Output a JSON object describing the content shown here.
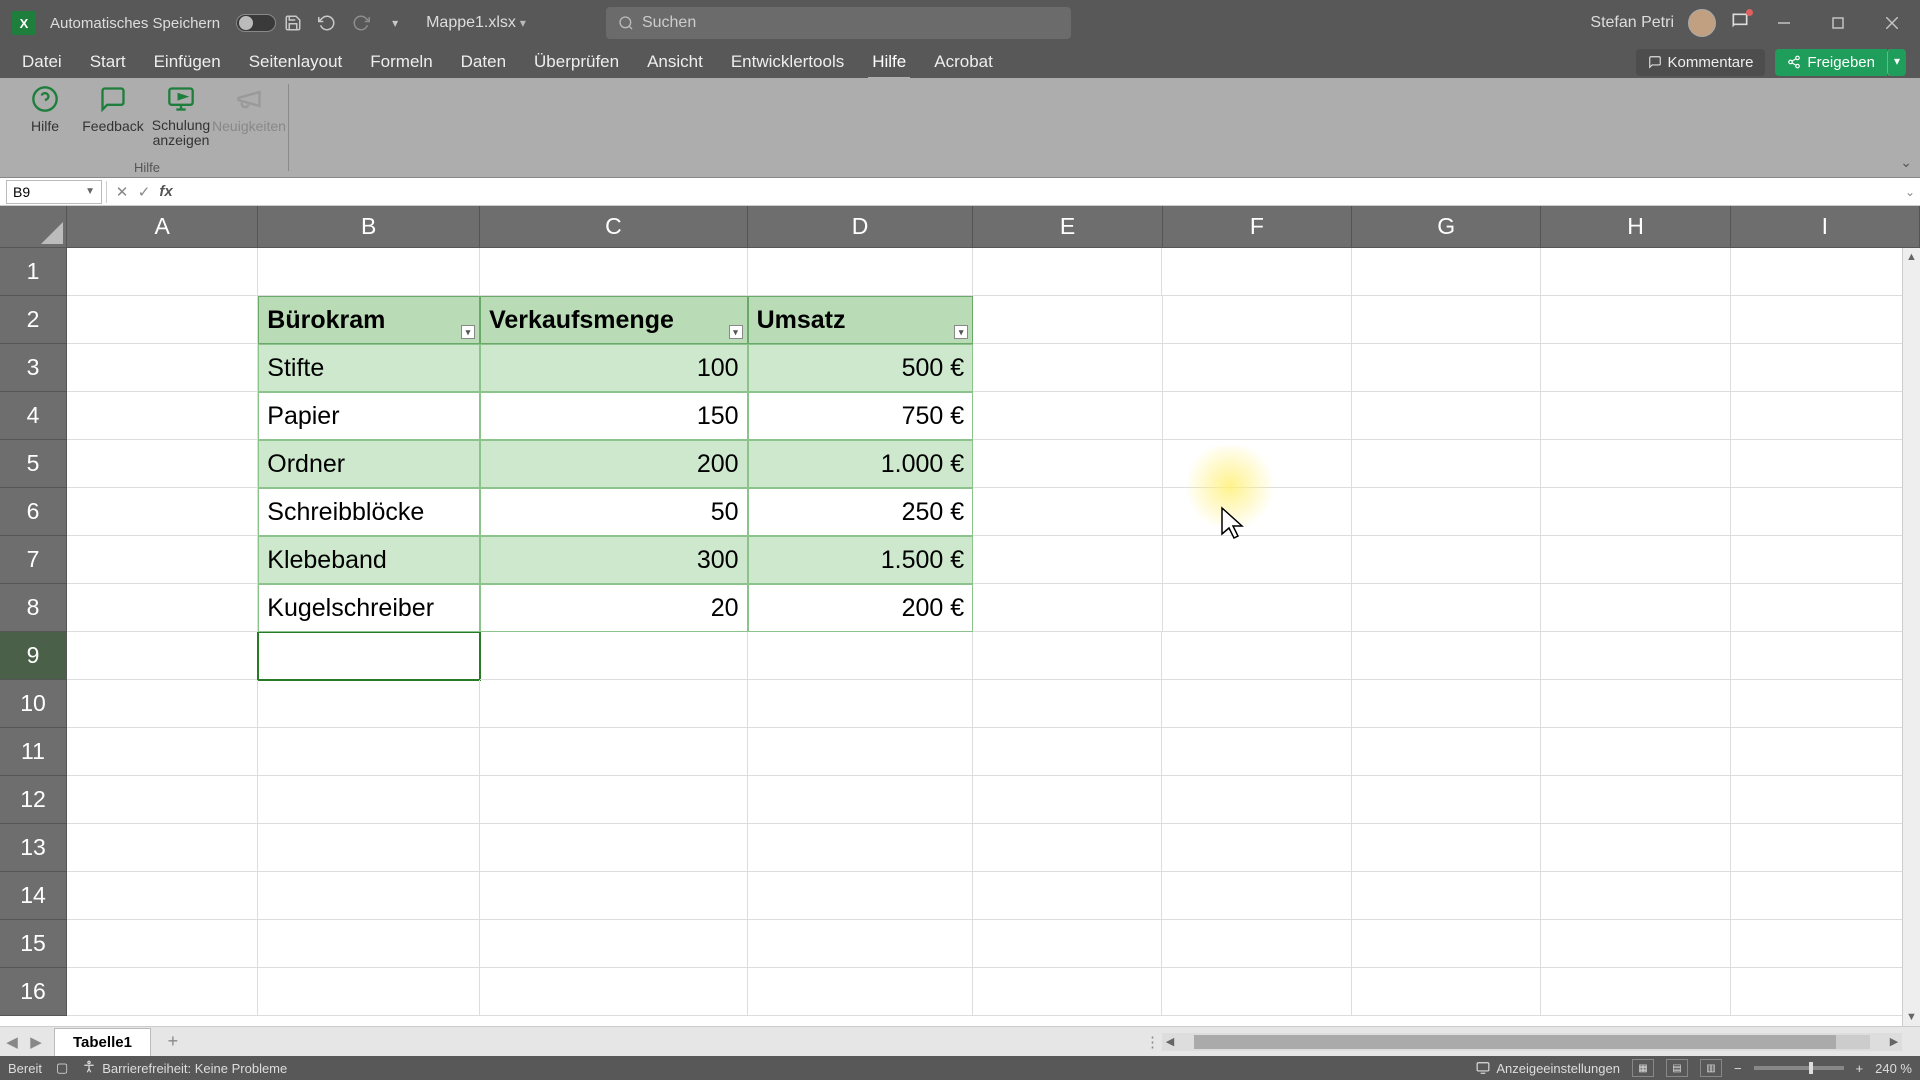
{
  "titlebar": {
    "autosave_label": "Automatisches Speichern",
    "doc_name": "Mappe1.xlsx",
    "search_placeholder": "Suchen",
    "user_name": "Stefan Petri"
  },
  "tabs": {
    "items": [
      "Datei",
      "Start",
      "Einfügen",
      "Seitenlayout",
      "Formeln",
      "Daten",
      "Überprüfen",
      "Ansicht",
      "Entwicklertools",
      "Hilfe",
      "Acrobat"
    ],
    "active_index": 9,
    "comments": "Kommentare",
    "share": "Freigeben"
  },
  "ribbon": {
    "help_btn": "Hilfe",
    "feedback_btn": "Feedback",
    "training_btn": "Schulung anzeigen",
    "news_btn": "Neuigkeiten",
    "group_label": "Hilfe"
  },
  "namebox": {
    "value": "B9"
  },
  "columns": [
    "A",
    "B",
    "C",
    "D",
    "E",
    "F",
    "G",
    "H",
    "I"
  ],
  "rows": [
    "1",
    "2",
    "3",
    "4",
    "5",
    "6",
    "7",
    "8",
    "9",
    "10",
    "11",
    "12",
    "13",
    "14",
    "15",
    "16"
  ],
  "table": {
    "headers": [
      "Bürokram",
      "Verkaufsmenge",
      "Umsatz"
    ],
    "rows": [
      {
        "name": "Stifte",
        "qty": "100",
        "rev": "500 €"
      },
      {
        "name": "Papier",
        "qty": "150",
        "rev": "750 €"
      },
      {
        "name": "Ordner",
        "qty": "200",
        "rev": "1.000 €"
      },
      {
        "name": "Schreibblöcke",
        "qty": "50",
        "rev": "250 €"
      },
      {
        "name": "Klebeband",
        "qty": "300",
        "rev": "1.500 €"
      },
      {
        "name": "Kugelschreiber",
        "qty": "20",
        "rev": "200 €"
      }
    ]
  },
  "sheets": {
    "tab1": "Tabelle1"
  },
  "status": {
    "ready": "Bereit",
    "accessibility": "Barrierefreiheit: Keine Probleme",
    "display_settings": "Anzeigeeinstellungen",
    "zoom": "240 %"
  }
}
